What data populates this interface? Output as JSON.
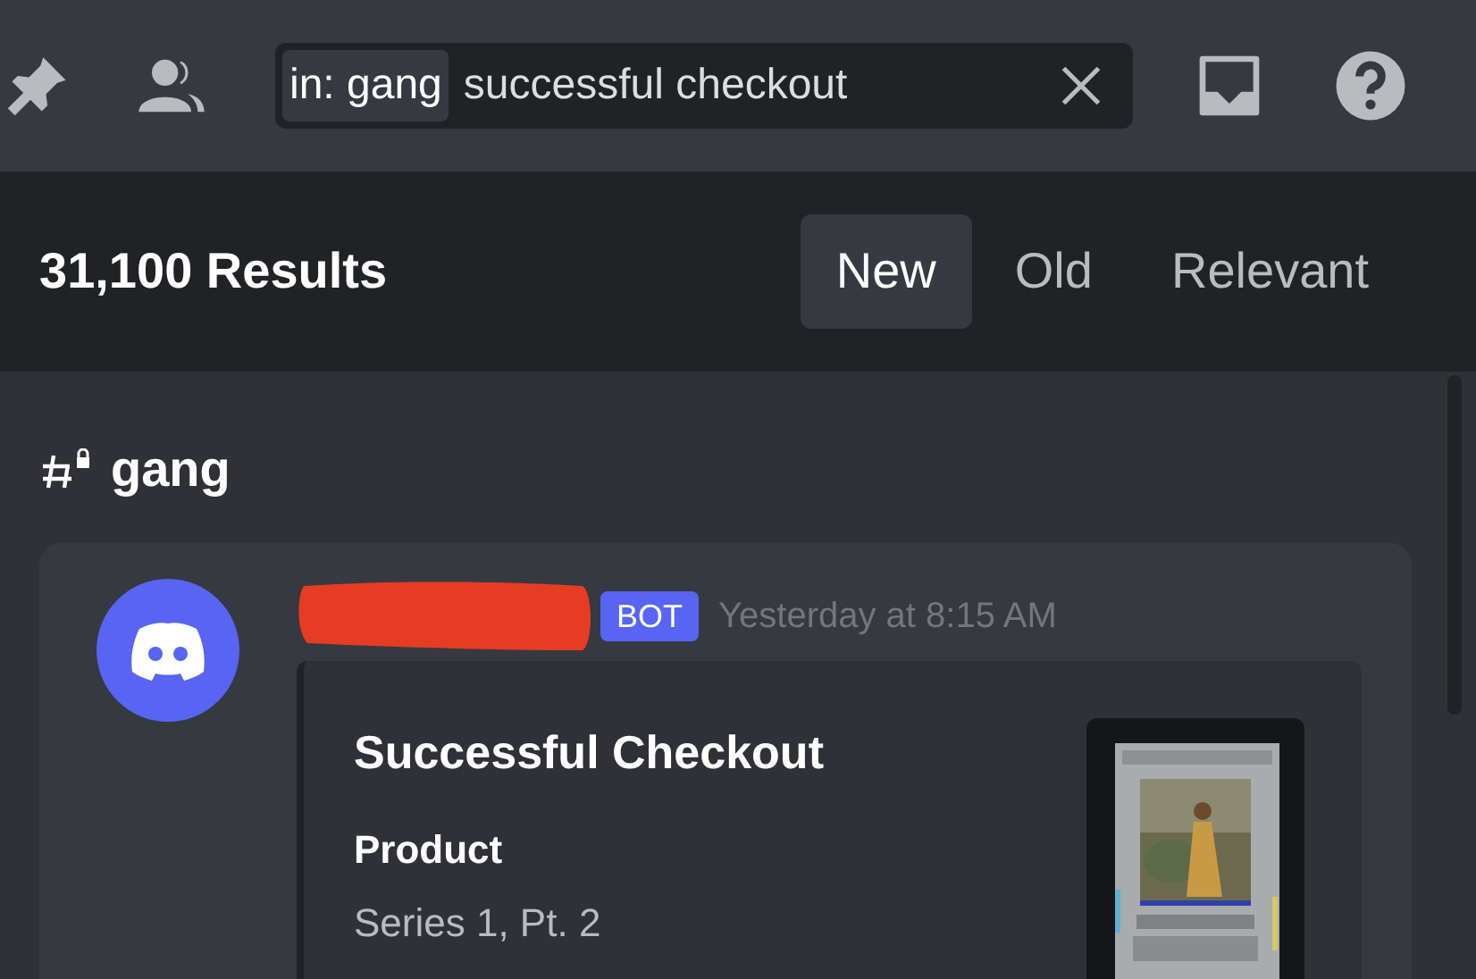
{
  "search": {
    "filter_chip": "in: gang",
    "query": "successful checkout"
  },
  "results": {
    "count": "31,100 Results",
    "sort_tabs": [
      {
        "label": "New",
        "selected": true
      },
      {
        "label": "Old",
        "selected": false
      },
      {
        "label": "Relevant",
        "selected": false
      }
    ]
  },
  "channel": {
    "name": "gang"
  },
  "message": {
    "badge": "BOT",
    "timestamp": "Yesterday at 8:15 AM",
    "embed": {
      "title": "Successful Checkout",
      "fields": [
        {
          "name": "Product",
          "value": "Series 1, Pt. 2"
        }
      ]
    }
  }
}
